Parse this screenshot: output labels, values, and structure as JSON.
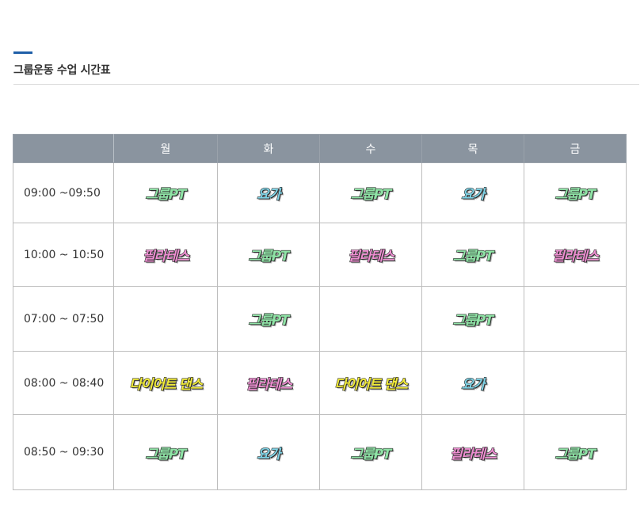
{
  "page": {
    "title": "그룹운동 수업 시간표"
  },
  "colors": {
    "title_accent": "#1f5fa8",
    "header_bg": "#8a949f",
    "class_colors": {
      "그룹PT": "#8fe3a6",
      "요가": "#7fd3e6",
      "필라테스": "#ee8fd2",
      "다이어트 댄스": "#f2ec3a"
    }
  },
  "schedule": {
    "days": [
      "월",
      "화",
      "수",
      "목",
      "금"
    ],
    "rows": [
      {
        "time": "09:00 ~09:50",
        "classes": [
          "그룹PT",
          "요가",
          "그룹PT",
          "요가",
          "그룹PT"
        ]
      },
      {
        "time": "10:00 ~ 10:50",
        "classes": [
          "필라테스",
          "그룹PT",
          "필라테스",
          "그룹PT",
          "필라테스"
        ]
      },
      {
        "time": "07:00 ~ 07:50",
        "classes": [
          "",
          "그룹PT",
          "",
          "그룹PT",
          ""
        ]
      },
      {
        "time": "08:00 ~ 08:40",
        "classes": [
          "다이어트 댄스",
          "필라테스",
          "다이어트 댄스",
          "요가",
          ""
        ]
      },
      {
        "time": "08:50 ~ 09:30",
        "classes": [
          "그룹PT",
          "요가",
          "그룹PT",
          "필라테스",
          "그룹PT"
        ]
      }
    ]
  }
}
